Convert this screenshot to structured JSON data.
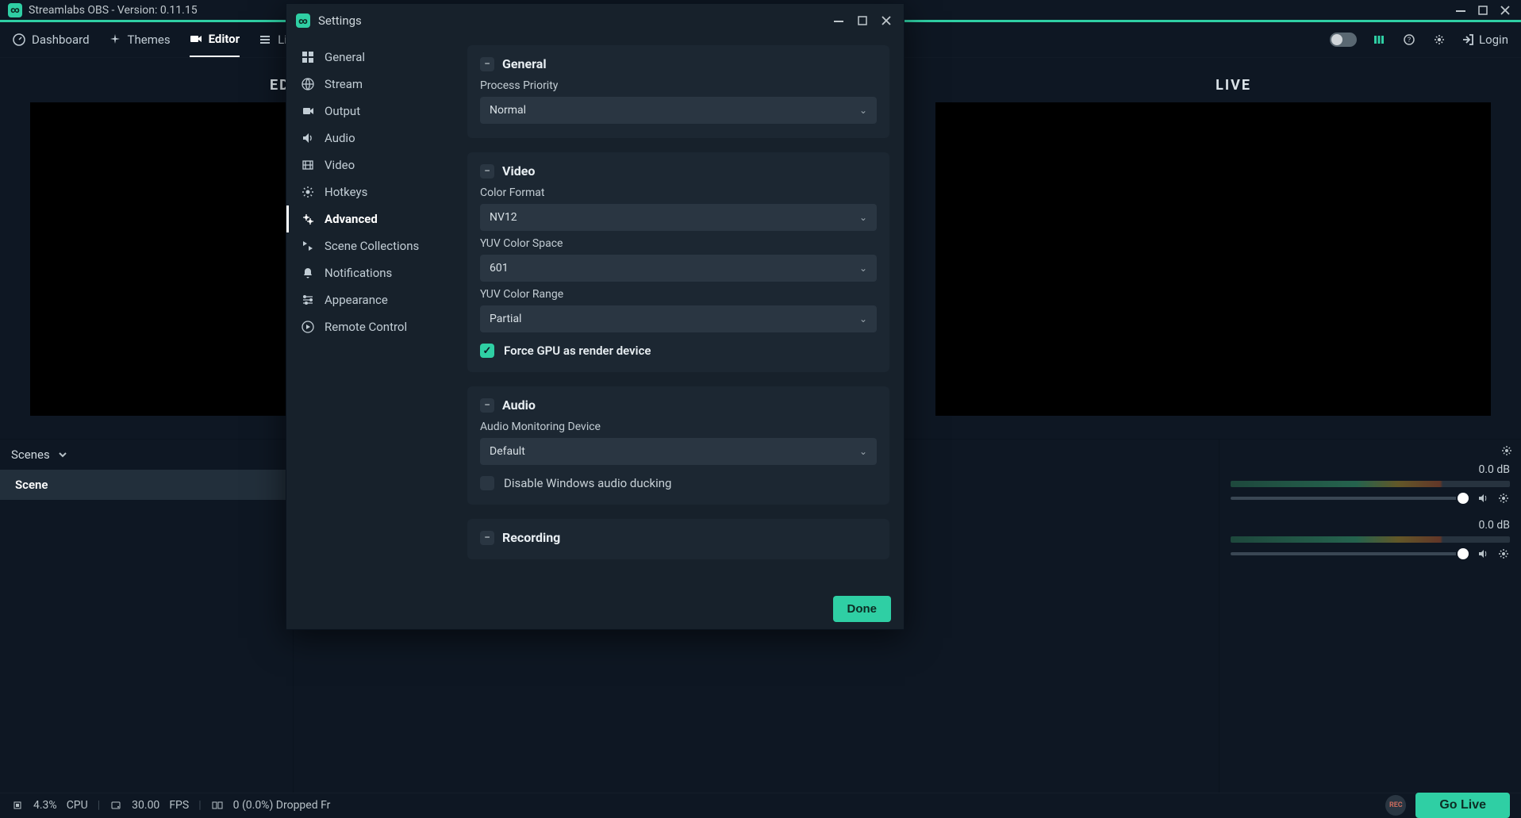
{
  "window": {
    "title": "Streamlabs OBS - Version: 0.11.15"
  },
  "nav": {
    "items": [
      {
        "label": "Dashboard"
      },
      {
        "label": "Themes"
      },
      {
        "label": "Editor"
      },
      {
        "label": "Live"
      }
    ],
    "login": "Login"
  },
  "editor": {
    "left_title": "EDIT",
    "right_title": "LIVE"
  },
  "panels": {
    "scenes_label": "Scenes",
    "scene_items": [
      "Scene"
    ]
  },
  "mixer": {
    "channels": [
      {
        "db": "0.0 dB"
      },
      {
        "db": "0.0 dB"
      }
    ]
  },
  "status": {
    "cpu_value": "4.3%",
    "cpu_label": "CPU",
    "fps_value": "30.00",
    "fps_label": "FPS",
    "dropped": "0 (0.0%) Dropped Fr",
    "golive": "Go Live",
    "rec": "REC"
  },
  "settings": {
    "title": "Settings",
    "sidebar": [
      "General",
      "Stream",
      "Output",
      "Audio",
      "Video",
      "Hotkeys",
      "Advanced",
      "Scene Collections",
      "Notifications",
      "Appearance",
      "Remote Control"
    ],
    "active_sidebar_index": 6,
    "done": "Done",
    "sections": {
      "general": {
        "title": "General",
        "process_priority_label": "Process Priority",
        "process_priority_value": "Normal"
      },
      "video": {
        "title": "Video",
        "color_format_label": "Color Format",
        "color_format_value": "NV12",
        "yuv_space_label": "YUV Color Space",
        "yuv_space_value": "601",
        "yuv_range_label": "YUV Color Range",
        "yuv_range_value": "Partial",
        "force_gpu_label": "Force GPU as render device",
        "force_gpu_checked": true
      },
      "audio": {
        "title": "Audio",
        "monitor_label": "Audio Monitoring Device",
        "monitor_value": "Default",
        "ducking_label": "Disable Windows audio ducking",
        "ducking_checked": false
      },
      "recording": {
        "title": "Recording"
      }
    }
  }
}
